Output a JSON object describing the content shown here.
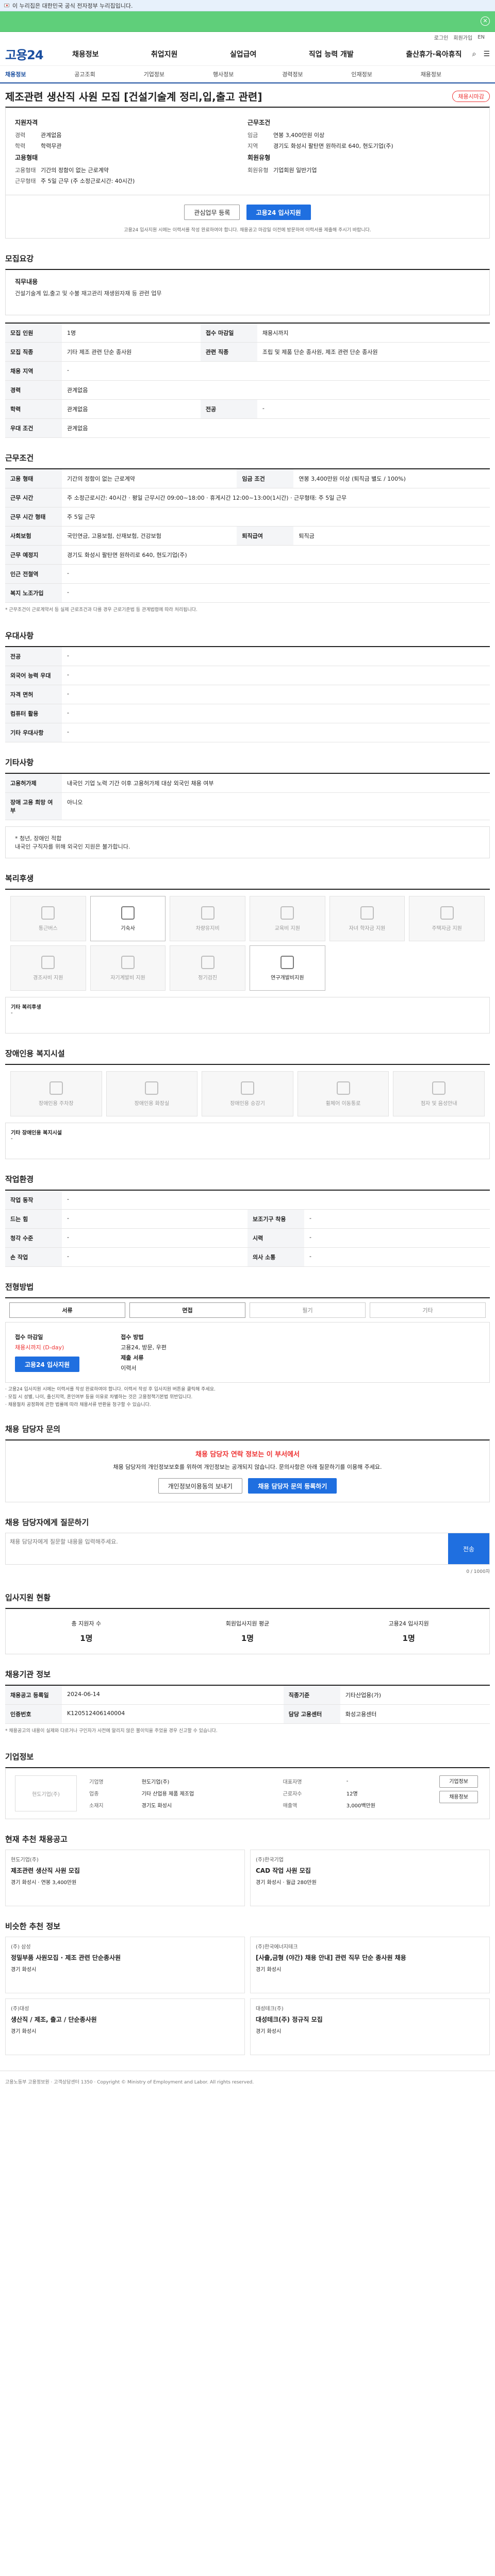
{
  "banner": {
    "text": "이 누리집은 대한민국 공식 전자정부 누리집입니다."
  },
  "util": {
    "a": "로그인",
    "b": "회원가입",
    "c": "EN"
  },
  "gnb": {
    "logo": "고용24",
    "menu": [
      "채용정보",
      "취업지원",
      "실업급여",
      "직업 능력 개발",
      "출산휴가·육아휴직"
    ],
    "right": [
      "⌕",
      "☰"
    ]
  },
  "lnb": {
    "items": [
      "채용정보",
      "공고조회",
      "기업정보",
      "행사정보",
      "경력정보",
      "인재정보",
      "채용정보"
    ],
    "on": 0
  },
  "title": {
    "text": "제조관련 생산직 사원 모집 [건설기술계 정리,입,출고 관련]",
    "badge": "채용시마감"
  },
  "summary": {
    "left_head": "지원자격",
    "left": [
      {
        "k": "경력",
        "v": "관계없음"
      },
      {
        "k": "학력",
        "v": "학력무관"
      }
    ],
    "left2_head": "고용형태",
    "left2": [
      {
        "k": "고용형태",
        "v": "기간의 정함이 없는 근로계약"
      },
      {
        "k": "근무형태",
        "v": "주 5일 근무 (주 소정근로시간: 40시간)"
      }
    ],
    "right_head": "근무조건",
    "right": [
      {
        "k": "임금",
        "v": "연봉 3,400만원 이상"
      },
      {
        "k": "지역",
        "v": "경기도 화성시 팔탄면 원하리로 640, 현도기업(주)"
      }
    ],
    "right2_head": "회원유형",
    "right2": [
      {
        "k": "회원유형",
        "v": "기업회원 일반기업"
      }
    ],
    "btn_interest": "관심업무 등록",
    "btn_apply": "고용24 입사지원",
    "note": "고용24 입사지원 시에는 이력서를 작성 완료하여야 합니다. 채용공고 마감일 이전에 방문하여 이력서를 제출해 주시기 바랍니다."
  },
  "s_recruit": {
    "title": "모집요강",
    "label": "직무내용",
    "text": "건설기술계 입,출고 및 수불 재고관리 재생원자재 등 관련 업무"
  },
  "recruit_rows": [
    {
      "k": "모집 인원",
      "v": "1명",
      "k2": "접수 마감일",
      "v2": "채용시까지"
    },
    {
      "k": "모집 직종",
      "v": "기타 제조 관련 단순 종사원",
      "k2": "관련 직종",
      "v2": "조립 및 제품 단순 종사원, 제조 관련 단순 종사원"
    },
    {
      "k": "채용 지역",
      "v": "-",
      "k2": "",
      "v2": ""
    },
    {
      "k": "경력",
      "v": "관계없음",
      "k2": "",
      "v2": ""
    },
    {
      "k": "학력",
      "v": "관계없음",
      "k2": "전공",
      "v2": "-"
    },
    {
      "k": "우대 조건",
      "v": "관계없음",
      "k2": "",
      "v2": ""
    }
  ],
  "s_cond": {
    "title": "근무조건"
  },
  "cond_rows": [
    {
      "k": "고용 형태",
      "v": "기간의 정함이 없는 근로계약",
      "k2": "임금 조건",
      "v2": "연봉 3,400만원 이상 (퇴직금 별도 / 100%)"
    },
    {
      "k": "근무 시간",
      "v": "주 소정근로시간: 40시간 · 평일 근무시간 09:00~18:00 · 휴게시간 12:00~13:00(1시간) · 근무형태: 주 5일 근무",
      "k2": "",
      "v2": ""
    },
    {
      "k": "근무 시간 형태",
      "v": "주 5일 근무",
      "k2": "",
      "v2": ""
    },
    {
      "k": "사회보험",
      "v": "국민연금, 고용보험, 산재보험, 건강보험",
      "k2": "퇴직급여",
      "v2": "퇴직금"
    },
    {
      "k": "근무 예정지",
      "v": "경기도 화성시 팔탄면 원하리로 640, 현도기업(주)",
      "k2": "",
      "v2": ""
    },
    {
      "k": "인근 전철역",
      "v": "-",
      "k2": "",
      "v2": ""
    },
    {
      "k": "복지 노조가입",
      "v": "-",
      "k2": "",
      "v2": ""
    }
  ],
  "cond_note": "* 근무조건이 근로계약서 등 실제 근로조건과 다를 경우 근로기준법 등 관계법령에 따라 처리됩니다.",
  "s_pref": {
    "title": "우대사항"
  },
  "pref_rows": [
    {
      "k": "전공",
      "v": "-"
    },
    {
      "k": "외국어 능력 우대",
      "v": "-"
    },
    {
      "k": "자격 면허",
      "v": "-"
    },
    {
      "k": "컴퓨터 활용",
      "v": "-"
    },
    {
      "k": "기타 우대사항",
      "v": "-"
    }
  ],
  "s_etc": {
    "title": "기타사항"
  },
  "etc_rows": [
    {
      "k": "고용허가제",
      "v": "내국인 기업 노력 기간 이후 고용허가제 대상 외국인 채용 여부"
    },
    {
      "k": "장애 고용 희망 여부",
      "v": "아니오"
    }
  ],
  "etc_note": "* 청년, 장애인 적합\n내국인 구직자를 위해 외국인 지원은 불가합니다.",
  "s_welfare": {
    "title": "복리후생"
  },
  "welfare": [
    "통근버스",
    "기숙사",
    "차량유지비",
    "교육비 지원",
    "자녀 학자금 지원",
    "주택자금 지원",
    "경조사비 지원",
    "자기계발비 지원",
    "정기검진",
    "연구개발비지원"
  ],
  "welfare_on": [
    1,
    9
  ],
  "welfare_extra": {
    "k": "기타 복리후생",
    "v": "-"
  },
  "s_disab": {
    "title": "장애인용 복지시설"
  },
  "disab": [
    "장애인용 주차장",
    "장애인용 화장실",
    "장애인용 승강기",
    "휠체어 이동통로",
    "점자 및 음성안내"
  ],
  "disab_extra": {
    "k": "기타 장애인용 복지시설",
    "v": "-"
  },
  "s_env": {
    "title": "작업환경"
  },
  "env_rows": [
    {
      "k": "작업 동작",
      "v": "-",
      "k2": "",
      "v2": ""
    },
    {
      "k": "드는 힘",
      "v": "-",
      "k2": "보조기구 착용",
      "v2": "-"
    },
    {
      "k": "청각 수준",
      "v": "-",
      "k2": "시력",
      "v2": "-"
    },
    {
      "k": "손 작업",
      "v": "-",
      "k2": "의사 소통",
      "v2": "-"
    }
  ],
  "s_method": {
    "title": "전형방법"
  },
  "method": [
    "서류",
    "면접",
    "필기",
    "기타"
  ],
  "method_on": [
    0,
    1
  ],
  "apply": {
    "k1": "접수 마감일",
    "v1": "채용시까지 (D-day)",
    "k2": "접수 방법",
    "v2": "고용24, 방문, 우편",
    "k3": "제출 서류",
    "v3": "이력서",
    "btn": "고용24 입사지원"
  },
  "apply_notices": [
    "· 고용24 입사지원 시에는 이력서를 작성 완료하여야 합니다. 이력서 작성 후 입사지원 버튼을 클릭해 주세요.",
    "· 모집 시 성별, 나이, 출신지역, 혼인여부 등을 이유로 차별하는 것은 고용정책기본법 위반입니다.",
    "· 채용절차 공정화에 관한 법률에 따라 채용서류 반환을 청구할 수 있습니다."
  ],
  "s_contact": {
    "title": "채용 담당자 문의"
  },
  "contact": {
    "head": "채용 담당자 연락 정보는 이 부서에서",
    "text": "채용 담당자의 개인정보보호를 위하여 개인정보는 공개되지 않습니다. 문의사항은 아래 질문하기를 이용해 주세요.",
    "btn1": "개인정보이용동의 보내기",
    "btn2": "채용 담당자 문의 등록하기"
  },
  "qna": {
    "title": "채용 담당자에게 질문하기",
    "placeholder": "채용 담당자에게 질문할 내용을 입력해주세요.",
    "send": "전송",
    "hint": "0 / 1000자"
  },
  "s_stat": {
    "title": "입사지원 현황",
    "more": "지원자 수"
  },
  "stats": [
    {
      "k": "총 지원자 수",
      "v": "1명"
    },
    {
      "k": "회원입사지원 평균",
      "v": "1명"
    },
    {
      "k": "고용24 입사지원",
      "v": "1명"
    }
  ],
  "s_info": {
    "title": "채용기관 정보"
  },
  "info_rows": [
    {
      "k": "채용공고 등록일",
      "v": "2024-06-14",
      "k2": "직종기준",
      "v2": "기타산업용(가)"
    },
    {
      "k": "인증번호",
      "v": "K120512406140004",
      "k2": "담당 고용센터",
      "v2": "화성고용센터"
    }
  ],
  "info_note": "* 채용공고의 내용이 실제와 다르거나 구인자가 사전에 알리지 않은 불이익을 주었을 경우 신고할 수 있습니다.",
  "s_corp": {
    "title": "기업정보"
  },
  "corp": {
    "name": "현도기업(주)",
    "rows": [
      {
        "k": "기업명",
        "v": "현도기업(주)",
        "k2": "대표자명",
        "v2": "-"
      },
      {
        "k": "업종",
        "v": "기타 산업용 제품 제조업",
        "k2": "근로자수",
        "v2": "12명"
      },
      {
        "k": "소재지",
        "v": "경기도 화성시",
        "k2": "매출액",
        "v2": "3,000백만원"
      }
    ],
    "btn1": "기업정보",
    "btn2": "채용정보"
  },
  "s_related": {
    "title": "현재 추천 채용공고"
  },
  "related": [
    {
      "co": "현도기업(주)",
      "ti": "제조관련 생산직 사원 모집",
      "meta": "경기 화성시 · 연봉 3,400만원"
    },
    {
      "co": "(주)한국기업",
      "ti": "CAD 작업 사원 모집",
      "meta": "경기 화성시 · 월급 280만원"
    }
  ],
  "s_similar": {
    "title": "비슷한 추천 정보"
  },
  "similar": [
    {
      "co": "(주) 삼성",
      "ti": "정밀부품 사원모집 · 제조 관련 단순종사원",
      "meta": "경기 화성시"
    },
    {
      "co": "(주)한국에너지테크",
      "ti": "[사출,금형 (야간) 채용 안내] 관련 직무 단순 종사원 채용",
      "meta": "경기 화성시"
    },
    {
      "co": "(주)대성",
      "ti": "생산직 / 제조, 출고 / 단순종사원",
      "meta": "경기 화성시"
    },
    {
      "co": "대성테크(주)",
      "ti": "대성테크(주) 정규직 모집",
      "meta": "경기 화성시"
    }
  ],
  "footer": {
    "text": "고용노동부 고용정보원 · 고객상담센터 1350 · Copyright © Ministry of Employment and Labor. All rights reserved."
  },
  "colors": {
    "accent": "#1f6fe0",
    "top": "#5fcf7a",
    "alert": "#e33"
  }
}
